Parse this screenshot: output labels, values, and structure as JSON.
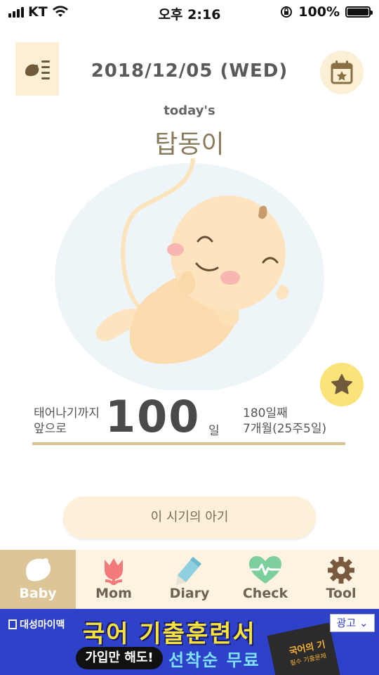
{
  "status_bar": {
    "carrier": "KT",
    "time": "오후 2:16",
    "battery": "100%",
    "battery_level": 1.0
  },
  "header": {
    "date": "2018/12/05 (WED)",
    "todays_label": "today's",
    "baby_name": "탑동이"
  },
  "countdown": {
    "left_line1": "태어나기까지",
    "left_line2": "앞으로",
    "days": "100",
    "unit": "일",
    "right_line1": "180일째",
    "right_line2": "7개월(25주5일)"
  },
  "this_period_button": "이 시기의 아기",
  "tabs": [
    {
      "label": "Baby",
      "icon": "baby-icon",
      "active": true
    },
    {
      "label": "Mom",
      "icon": "tulip-icon",
      "active": false
    },
    {
      "label": "Diary",
      "icon": "pencil-icon",
      "active": false
    },
    {
      "label": "Check",
      "icon": "heartbeat-icon",
      "active": false
    },
    {
      "label": "Tool",
      "icon": "gear-icon",
      "active": false
    }
  ],
  "ad": {
    "brand": "대성마이맥",
    "headline": "국어 기출훈련서",
    "pill": "가입만 해도!",
    "sub": "선착순 무료",
    "badge": "광고",
    "book_title": "국어의 기",
    "book_sub": "필수 기출문제"
  },
  "colors": {
    "tab_bar_bg": "#fdf3e0",
    "tab_active_bg": "#dcc596",
    "accent_cream": "#fbefd6",
    "star_yellow": "#fbe37a",
    "ad_blue": "#2e41c9"
  }
}
